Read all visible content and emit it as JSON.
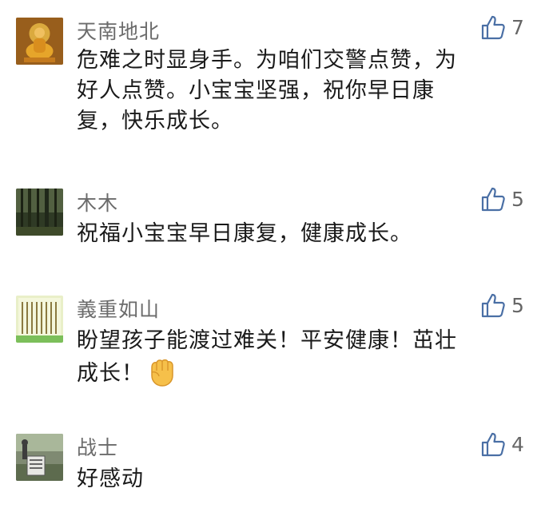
{
  "comments": [
    {
      "author": "天南地北",
      "likes": "7",
      "avatar_icon": "buddha-statue-icon",
      "lines": [
        "危难之时显身手。为咱们交警点赞，为",
        "好人点赞。小宝宝坚强，祝你早日康",
        "复，快乐成长。"
      ]
    },
    {
      "author": "木木",
      "likes": "5",
      "avatar_icon": "forest-icon",
      "lines": [
        "祝福小宝宝早日康复，健康成长。"
      ]
    },
    {
      "author": "義重如山",
      "likes": "5",
      "avatar_icon": "calligraphy-icon",
      "lines": [
        "盼望孩子能渡过难关！平安健康！茁壮",
        "成长！"
      ],
      "emoji_icon": "raised-fist-emoji-icon"
    },
    {
      "author": "战士",
      "likes": "4",
      "avatar_icon": "stone-tablet-icon",
      "lines": [
        "好感动"
      ]
    }
  ],
  "colors": {
    "name": "#6b6b6b",
    "text": "#1a1a1a",
    "like_icon": "#4a6fa5"
  },
  "like_icon": "thumbs-up-icon"
}
